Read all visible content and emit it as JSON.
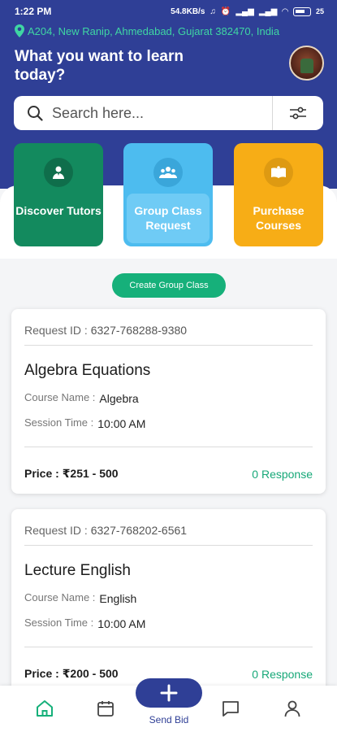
{
  "status_bar": {
    "time": "1:22 PM",
    "net_speed": "54.8KB/s",
    "battery": "25"
  },
  "location": "A204, New Ranip, Ahmedabad, Gujarat 382470, India",
  "headline": "What you want to learn today?",
  "search": {
    "placeholder": "Search here..."
  },
  "tiles": [
    {
      "label": "Discover Tutors",
      "icon": "tutor-icon",
      "color": "#138a5e"
    },
    {
      "label": "Group Class Request",
      "icon": "group-icon",
      "color": "#4dbcef"
    },
    {
      "label": "Purchase Courses",
      "icon": "book-icon",
      "color": "#f7ad16"
    }
  ],
  "create_button": "Create Group Class",
  "requests": [
    {
      "id_label": "Request ID :",
      "id": "6327-768288-9380",
      "title": "Algebra Equations",
      "course_label": "Course Name :",
      "course": "Algebra",
      "session_label": "Session Time :",
      "session": "10:00 AM",
      "price": "Price : ₹251 - 500",
      "responses": "0 Response"
    },
    {
      "id_label": "Request ID :",
      "id": "6327-768202-6561",
      "title": "Lecture English",
      "course_label": "Course Name :",
      "course": "English",
      "session_label": "Session Time :",
      "session": "10:00 AM",
      "price": "Price : ₹200 - 500",
      "responses": "0 Response"
    }
  ],
  "bottom_nav": {
    "send_bid": "Send Bid",
    "items": [
      "home-icon",
      "calendar-icon",
      "chat-icon",
      "profile-icon"
    ]
  },
  "colors": {
    "primary": "#2f3f96",
    "accent": "#16b07a"
  }
}
